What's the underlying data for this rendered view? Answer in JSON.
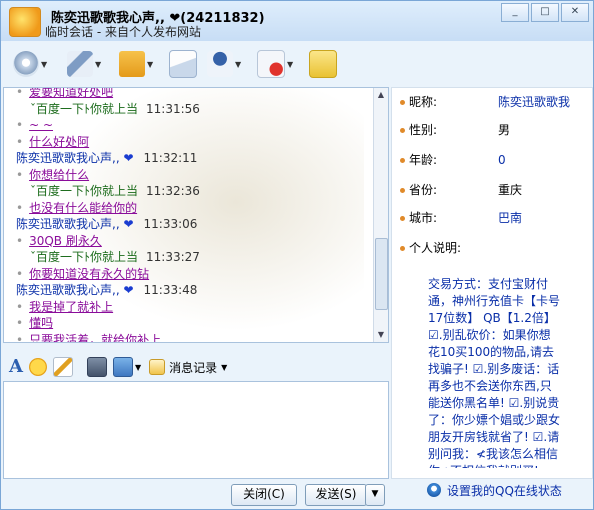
{
  "window": {
    "title": "陈奕迅歌歌我心声,, ❤(24211832)",
    "subtitle": "临时会话 - 来自个人发布网站",
    "buttons": [
      "_",
      "□",
      "✕"
    ]
  },
  "toolbar": {
    "items": [
      "webcam-icon",
      "microphone-icon",
      "folder-transfer-icon",
      "mail-icon",
      "contact-card-icon",
      "block-icon",
      "add-contact-icon"
    ]
  },
  "chat": {
    "messages": [
      {
        "type": "text",
        "text": "爱要知道好处吧"
      },
      {
        "type": "sys",
        "text": "ˇ百度一下ﾄ你就上当",
        "time": "11:31:56"
      },
      {
        "type": "text",
        "text": "~ ~"
      },
      {
        "type": "text",
        "text": "什么好处阿"
      },
      {
        "type": "sender",
        "name": "陈奕迅歌歌我心声,, ",
        "heart": "❤",
        "time": "11:32:11"
      },
      {
        "type": "text",
        "text": "你想给什么"
      },
      {
        "type": "sys",
        "text": "ˇ百度一下ﾄ你就上当",
        "time": "11:32:36"
      },
      {
        "type": "text",
        "text": "也没有什么能给你的"
      },
      {
        "type": "sender",
        "name": "陈奕迅歌歌我心声,, ",
        "heart": "❤",
        "time": "11:33:06"
      },
      {
        "type": "text",
        "text": "30QB  刷永久"
      },
      {
        "type": "sys",
        "text": "ˇ百度一下ﾄ你就上当",
        "time": "11:33:27"
      },
      {
        "type": "text",
        "text": "你要知道没有永久的钻"
      },
      {
        "type": "sender",
        "name": "陈奕迅歌歌我心声,, ",
        "heart": "❤",
        "time": "11:33:48"
      },
      {
        "type": "text",
        "text": "我是掉了就补上"
      },
      {
        "type": "text",
        "text": "懂吗"
      },
      {
        "type": "text",
        "text": "只要我活着，就给你补上"
      }
    ]
  },
  "format_bar": {
    "message_log": "消息记录"
  },
  "buttons": {
    "close": "关闭(C)",
    "send": "发送(S)",
    "send_arrow": "▼"
  },
  "profile": {
    "rows": [
      {
        "label": "昵称:",
        "value": "陈奕迅歌歌我"
      },
      {
        "label": "性别:",
        "value": "男"
      },
      {
        "label": "年龄:",
        "value": "0"
      },
      {
        "label": "省份:",
        "value": "重庆"
      },
      {
        "label": "城市:",
        "value": "巴南"
      },
      {
        "label": "个人说明:",
        "value": ""
      }
    ],
    "description": "交易方式：支付宝财付通，神州行充值卡【卡号17位数】 QB【1.2倍】☑.别乱砍价：如果你想花10买100的物品,请去找骗子! ☑.别多废话：话再多也不会送你东西,只能送你黑名单! ☑.别说贵了：你少嫖个娼或少跟女朋友开房钱就省了! ☑.请别问我：≮我该怎么相信你≯不相信我就别买!",
    "qq_status": "设置我的QQ在线状态"
  }
}
